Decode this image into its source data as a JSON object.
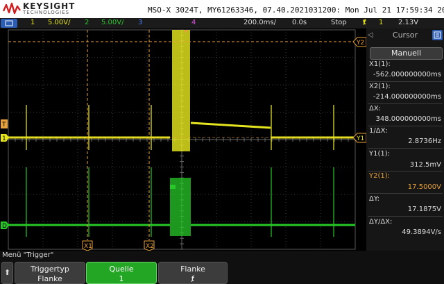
{
  "header": {
    "brand": "KEYSIGHT",
    "brand_sub": "TECHNOLOGIES",
    "model_info": "MSO-X 3024T, MY61263346, 07.40.2021031200: Mon Jul 21 17:59:34 2025"
  },
  "statusbar": {
    "ch1_num": "1",
    "ch1_scale": "5.00V/",
    "ch2_num": "2",
    "ch2_scale": "5.00V/",
    "ch3_num": "3",
    "ch4_num": "4",
    "time_scale": "200.0ms/",
    "delay": "0.0s",
    "run_state": "Stop",
    "trig_symbol": "ⱦ",
    "trig_source": "1",
    "trig_level": "2.13V"
  },
  "grid_labels": {
    "y2": "Y2",
    "y1": "Y1",
    "x1": "X1",
    "x2": "X2",
    "trigger_marker": "T",
    "ch1_marker": "1",
    "ch2_marker": "D"
  },
  "cursor_panel": {
    "title": "Cursor",
    "mode": "Manuell",
    "x1_label": "X1(1):",
    "x1_value": "-562.000000000ms",
    "x2_label": "X2(1):",
    "x2_value": "-214.000000000ms",
    "dx_label": "ΔX:",
    "dx_value": "348.000000000ms",
    "inv_dx_label": "1/ΔX:",
    "inv_dx_value": "2.8736Hz",
    "y1_label": "Y1(1):",
    "y1_value": "312.5mV",
    "y2_label": "Y2(1):",
    "y2_value": "17.5000V",
    "dy_label": "ΔY:",
    "dy_value": "17.1875V",
    "dydx_label": "ΔY/ΔX:",
    "dydx_value": "49.3894V/s"
  },
  "bottom_menu": {
    "title": "Menü \"Trigger\"",
    "up_arrow": "⬆",
    "softkeys": [
      {
        "label": "Triggertyp",
        "value": "Flanke"
      },
      {
        "label": "Quelle",
        "value": "1"
      },
      {
        "label": "Flanke",
        "value": "ⱦ"
      }
    ]
  },
  "colors": {
    "ch1": "#e6e620",
    "ch2": "#27c927",
    "ch3": "#4d7dff",
    "ch4": "#e24be2",
    "cursor": "#e8a23a",
    "active_key": "#23a623",
    "accent_blue": "#2a5db3"
  }
}
